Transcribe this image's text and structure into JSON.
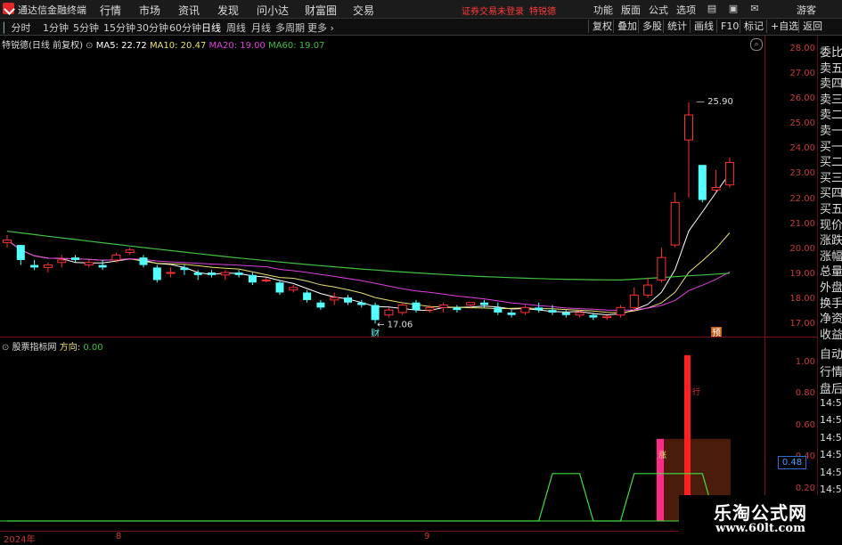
{
  "app": {
    "title": "通达信金融终端",
    "menu": [
      "行情",
      "市场",
      "资讯",
      "发现",
      "问小达",
      "财富圈",
      "交易"
    ],
    "notice_login": "证券交易未登录",
    "stock_name_top": "特锐德",
    "right_menu": [
      "功能",
      "版面",
      "公式",
      "选项"
    ],
    "guest": "游客"
  },
  "periods": [
    "分时",
    "1分钟",
    "5分钟",
    "15分钟",
    "30分钟",
    "60分钟",
    "日线",
    "周线",
    "月线",
    "多周期",
    "更多"
  ],
  "active_period": "日线",
  "toolbar_right": [
    "复权",
    "叠加",
    "多股",
    "统计",
    "画线",
    "F10",
    "标记",
    "+自选",
    "返回"
  ],
  "main_info": {
    "stock": "特锐德(日线 前复权)",
    "ma5": "MA5: 22.72",
    "ma10": "MA10: 20.47",
    "ma20": "MA20: 19.00",
    "ma60": "MA60: 19.07",
    "colors": {
      "ma5": "#ffffff",
      "ma10": "#e8e070",
      "ma20": "#e040e0",
      "ma60": "#40c040"
    }
  },
  "sub_info": {
    "name": "股票指标网",
    "direction_label": "方向:",
    "direction_value": "0.00"
  },
  "price_axis": [
    "28.00",
    "27.00",
    "26.00",
    "25.00",
    "24.00",
    "23.00",
    "22.00",
    "21.00",
    "20.00",
    "19.00",
    "18.00",
    "17.00"
  ],
  "sub_axis": [
    "1.00",
    "0.80",
    "0.60",
    "0.40",
    "0.20"
  ],
  "sub_cursor_value": "0.48",
  "x_axis": [
    "2024年",
    "8",
    "9"
  ],
  "annotations": {
    "high": "25.90",
    "low": "17.06",
    "cai": "财",
    "yu": "预",
    "xing": "行",
    "zhang": "涨"
  },
  "side_panel": [
    "委比",
    "卖五",
    "卖四",
    "卖三",
    "卖二",
    "卖一",
    "买一",
    "买二",
    "买三",
    "买四",
    "买五",
    "现价",
    "涨跌",
    "涨幅",
    "总量",
    "外盘",
    "换手",
    "净资",
    "收益"
  ],
  "side_panel_bottom": [
    "自动",
    "行情",
    "盘后",
    "14:50",
    "14:50",
    "14:50",
    "14:50",
    "14:50",
    "14:50",
    "14:50"
  ],
  "watermark": {
    "line1": "乐淘公式网",
    "line2": "www.60lt.com"
  },
  "chart_data": {
    "type": "candlestick",
    "ylim": [
      16.8,
      28.2
    ],
    "candles": [
      [
        20.3,
        20.6,
        20.1,
        20.4
      ],
      [
        20.2,
        20.2,
        19.4,
        19.6
      ],
      [
        19.4,
        19.6,
        19.2,
        19.3
      ],
      [
        19.3,
        19.5,
        19.1,
        19.4
      ],
      [
        19.5,
        19.8,
        19.3,
        19.6
      ],
      [
        19.7,
        19.8,
        19.5,
        19.6
      ],
      [
        19.4,
        19.6,
        19.3,
        19.5
      ],
      [
        19.4,
        19.6,
        19.2,
        19.3
      ],
      [
        19.6,
        19.9,
        19.5,
        19.8
      ],
      [
        19.9,
        20.1,
        19.8,
        20.0
      ],
      [
        19.7,
        19.8,
        19.3,
        19.4
      ],
      [
        19.3,
        19.4,
        18.7,
        18.8
      ],
      [
        19.1,
        19.3,
        18.9,
        19.1
      ],
      [
        19.3,
        19.4,
        19.0,
        19.2
      ],
      [
        19.1,
        19.2,
        18.8,
        19.0
      ],
      [
        19.1,
        19.2,
        18.9,
        19.0
      ],
      [
        19.0,
        19.2,
        18.8,
        19.1
      ],
      [
        19.1,
        19.2,
        18.9,
        19.0
      ],
      [
        19.0,
        19.1,
        18.6,
        18.7
      ],
      [
        18.8,
        18.9,
        18.7,
        18.8
      ],
      [
        18.7,
        18.8,
        18.2,
        18.3
      ],
      [
        18.4,
        18.6,
        18.3,
        18.5
      ],
      [
        18.3,
        18.4,
        17.9,
        18.0
      ],
      [
        17.9,
        18.0,
        17.6,
        17.7
      ],
      [
        18.0,
        18.3,
        17.8,
        18.1
      ],
      [
        18.1,
        18.2,
        17.8,
        17.9
      ],
      [
        17.9,
        18.0,
        17.7,
        17.8
      ],
      [
        17.8,
        17.9,
        17.06,
        17.2
      ],
      [
        17.4,
        17.7,
        17.3,
        17.6
      ],
      [
        17.5,
        17.9,
        17.4,
        17.8
      ],
      [
        17.9,
        18.0,
        17.5,
        17.6
      ],
      [
        17.6,
        17.8,
        17.5,
        17.7
      ],
      [
        17.7,
        17.9,
        17.5,
        17.8
      ],
      [
        17.7,
        17.8,
        17.5,
        17.6
      ],
      [
        17.8,
        17.9,
        17.7,
        17.9
      ],
      [
        17.9,
        18.0,
        17.7,
        17.8
      ],
      [
        17.7,
        17.9,
        17.4,
        17.5
      ],
      [
        17.5,
        17.6,
        17.3,
        17.4
      ],
      [
        17.5,
        17.8,
        17.4,
        17.7
      ],
      [
        17.7,
        17.9,
        17.5,
        17.6
      ],
      [
        17.6,
        17.8,
        17.4,
        17.5
      ],
      [
        17.5,
        17.6,
        17.3,
        17.4
      ],
      [
        17.4,
        17.6,
        17.3,
        17.5
      ],
      [
        17.4,
        17.5,
        17.2,
        17.3
      ],
      [
        17.3,
        17.4,
        17.2,
        17.35
      ],
      [
        17.4,
        17.8,
        17.3,
        17.7
      ],
      [
        17.7,
        18.5,
        17.6,
        18.2
      ],
      [
        18.2,
        18.9,
        18.1,
        18.6
      ],
      [
        18.8,
        20.1,
        18.7,
        19.7
      ],
      [
        20.2,
        22.3,
        20.1,
        21.9
      ],
      [
        24.4,
        25.9,
        22.1,
        25.4
      ],
      [
        23.4,
        23.4,
        21.9,
        22.0
      ],
      [
        22.4,
        23.2,
        22.3,
        22.5
      ],
      [
        22.6,
        23.7,
        22.5,
        23.5
      ]
    ],
    "ma": [
      {
        "name": "MA5",
        "color": "#ffffff"
      },
      {
        "name": "MA10",
        "color": "#e8e070"
      },
      {
        "name": "MA20",
        "color": "#e040e0"
      },
      {
        "name": "MA60",
        "color": "#40c040"
      }
    ],
    "indicator": {
      "ylim": [
        0,
        1.1
      ],
      "step": [
        0,
        0,
        0,
        0,
        0,
        0,
        0,
        0,
        0,
        0,
        0,
        0,
        0,
        0,
        0,
        0,
        0,
        0,
        0,
        0,
        0,
        0,
        0,
        0,
        0,
        0,
        0,
        0,
        0,
        0,
        0,
        0,
        0,
        0,
        0,
        0,
        0,
        0,
        0,
        0,
        0.3,
        0.3,
        0.3,
        0,
        0,
        0,
        0.3,
        0.3,
        0.3,
        0.3,
        0.3,
        0.3,
        0,
        0
      ],
      "red_bar_value": 1.05,
      "pink_bar_value": 0.52,
      "brown_box_top": 0.52
    }
  }
}
